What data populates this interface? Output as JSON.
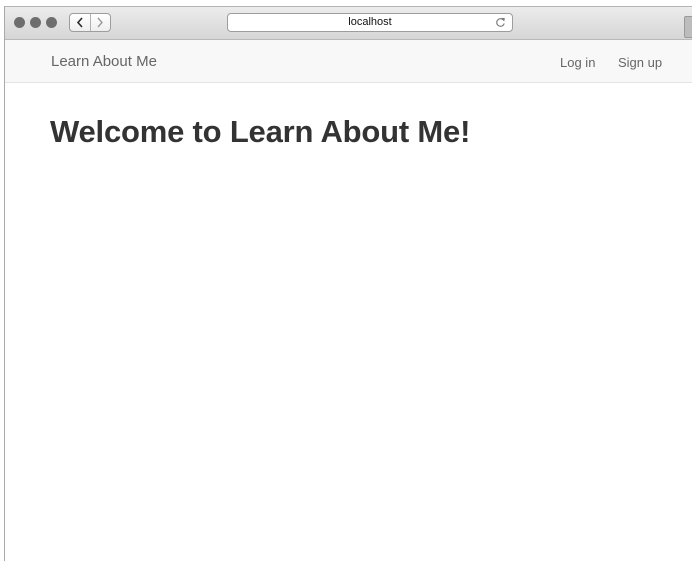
{
  "browser": {
    "url": "localhost",
    "icons": {
      "back": "chevron-left-icon",
      "forward": "chevron-right-icon",
      "reload": "reload-icon"
    }
  },
  "navbar": {
    "brand": "Learn About Me",
    "links": {
      "login": "Log in",
      "signup": "Sign up"
    }
  },
  "main": {
    "heading": "Welcome to Learn About Me!"
  },
  "colors": {
    "navbar_bg": "#f8f8f8",
    "nav_text": "#666666",
    "heading_text": "#333333"
  }
}
